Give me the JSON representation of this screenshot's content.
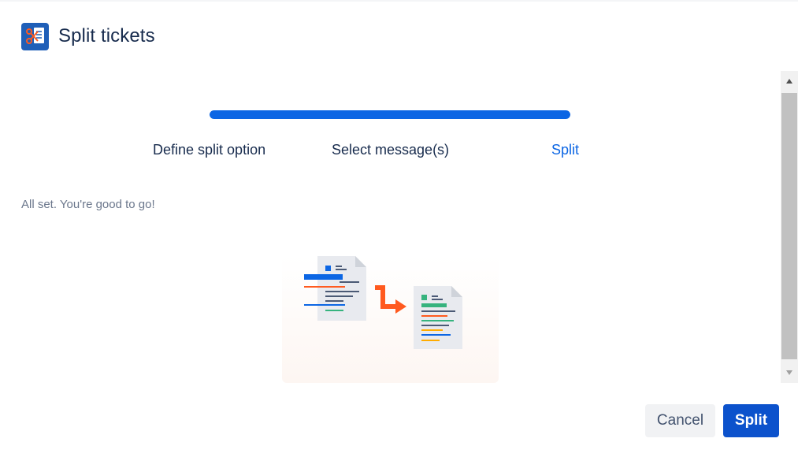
{
  "dialog": {
    "title": "Split tickets",
    "app_icon": "scissors-document-icon"
  },
  "stepper": {
    "progress": 1.0,
    "steps": [
      {
        "label": "Define split option",
        "active": false
      },
      {
        "label": "Select message(s)",
        "active": false
      },
      {
        "label": "Split",
        "active": true
      }
    ]
  },
  "status_message": "All set. You're good to go!",
  "illustration": "split-document-illustration",
  "footer": {
    "cancel_label": "Cancel",
    "split_label": "Split"
  },
  "colors": {
    "accent": "#0c66e4",
    "primary_button": "#0c52cc",
    "arrow_orange": "#ff5a1f",
    "text": "#172b4d",
    "muted_text": "#6b778c"
  }
}
